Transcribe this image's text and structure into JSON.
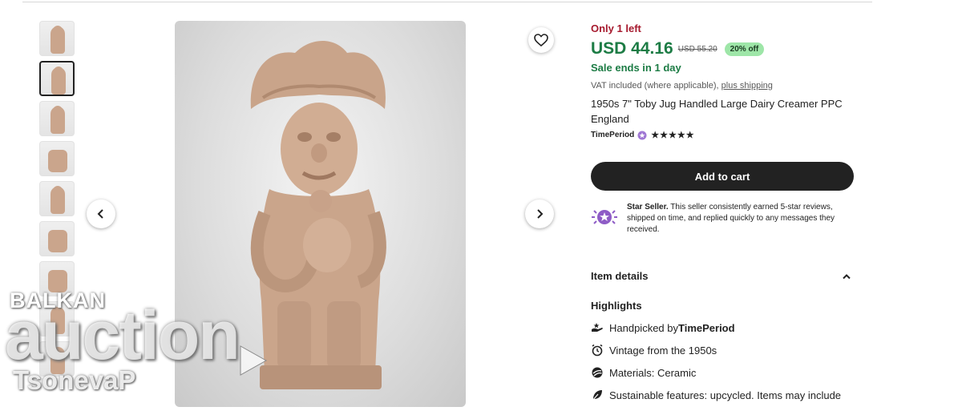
{
  "listing": {
    "only_left": "Only 1 left",
    "price": "USD 44.16",
    "original_price": "USD 55.20",
    "discount": "20% off",
    "sale_ends": "Sale ends in 1 day",
    "vat_text": "VAT included (where applicable),",
    "shipping_link": "plus shipping",
    "title": "1950s 7\" Toby Jug Handled Large Dairy Creamer PPC England",
    "shop_name": "TimePeriod",
    "rating_stars": "★★★★★",
    "add_to_cart": "Add to cart",
    "star_seller_label": "Star Seller.",
    "star_seller_text": " This seller consistently earned 5-star reviews, shipped on time, and replied quickly to any messages they received.",
    "item_details": "Item details",
    "highlights_heading": "Highlights",
    "highlights": [
      {
        "icon": "handpicked-icon",
        "prefix": "Handpicked by ",
        "bold": "TimePeriod"
      },
      {
        "icon": "clock-icon",
        "prefix": "Vintage from the 1950s",
        "bold": ""
      },
      {
        "icon": "materials-icon",
        "prefix": "Materials: Ceramic",
        "bold": ""
      },
      {
        "icon": "leaf-icon",
        "prefix": "Sustainable features: upcycled. Items may include",
        "bold": ""
      }
    ]
  },
  "gallery": {
    "selected_index": 1,
    "thumbnail_count": 10
  },
  "watermark": {
    "line1": "BALKAN",
    "line2": "auction",
    "line3": "TsonevaP"
  },
  "colors": {
    "price": "#1d7c45",
    "only_left": "#a61a2e",
    "discount_bg": "#9ee6a8",
    "button": "#222222",
    "star_seller": "#8e5cc6"
  }
}
